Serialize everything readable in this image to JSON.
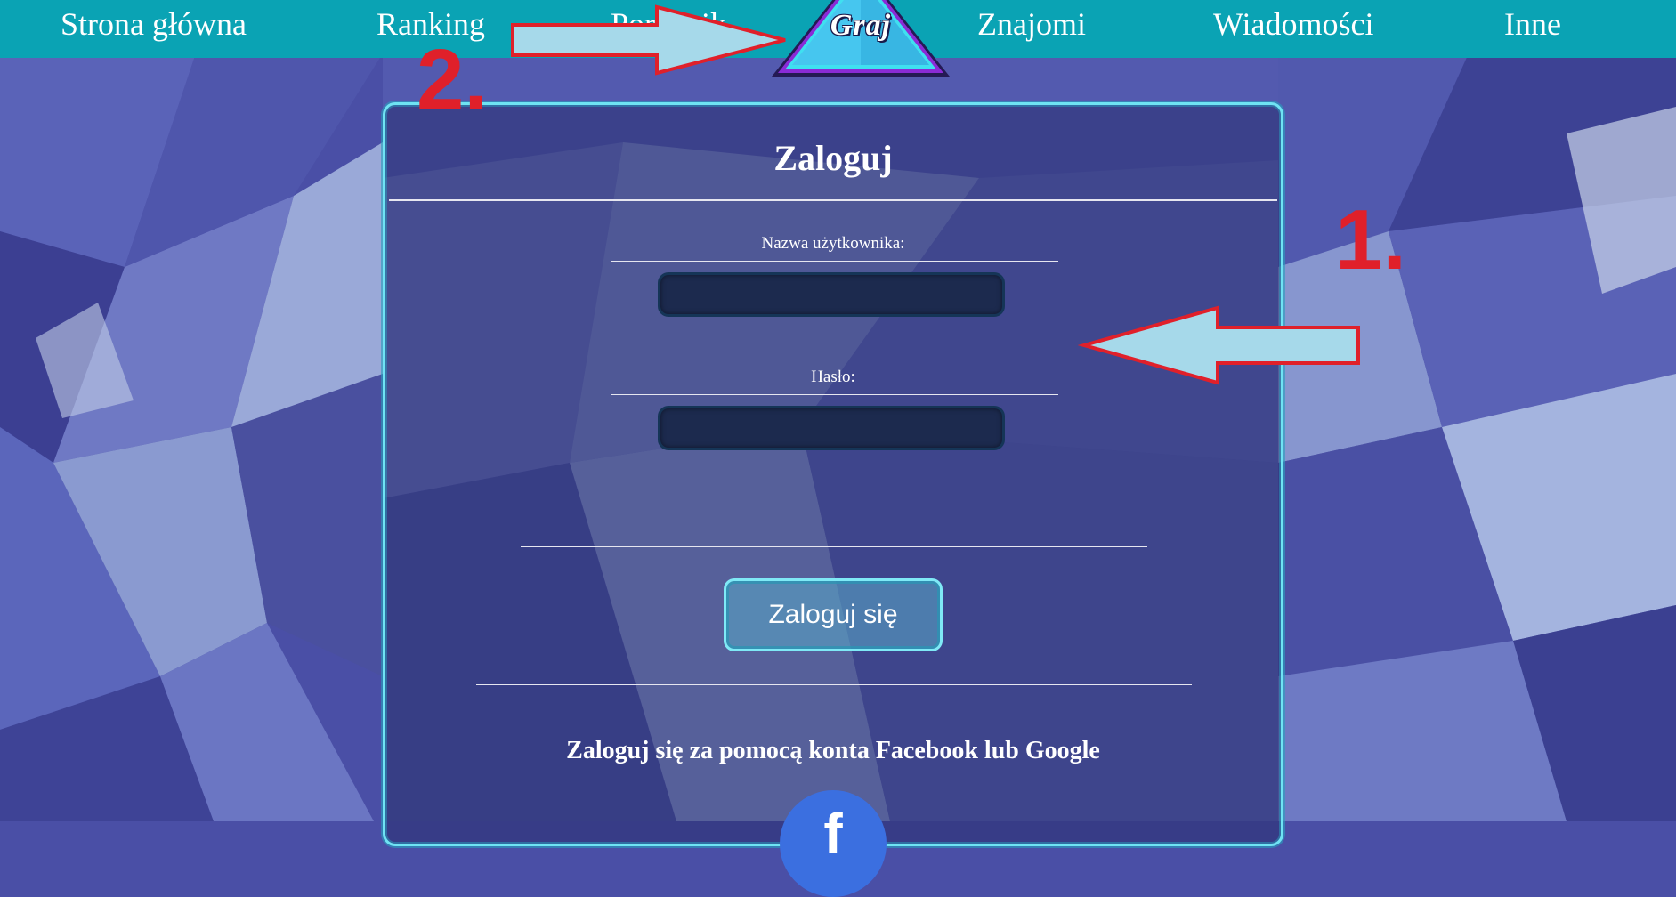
{
  "nav": {
    "items": [
      {
        "label": "Strona główna"
      },
      {
        "label": "Ranking"
      },
      {
        "label": "Poradnik"
      },
      {
        "label": "Znajomi"
      },
      {
        "label": "Wiadomości"
      },
      {
        "label": "Inne"
      }
    ],
    "play_logo_label": "Graj"
  },
  "login": {
    "title": "Zaloguj",
    "username_label": "Nazwa użytkownika:",
    "username_value": "",
    "password_label": "Hasło:",
    "password_value": "",
    "submit_label": "Zaloguj się",
    "social_text": "Zaloguj się za pomocą konta Facebook lub Google",
    "facebook_icon": "facebook-icon"
  },
  "annotations": {
    "marker_1": "1.",
    "marker_2": "2."
  },
  "colors": {
    "navbar": "#0aa3b4",
    "panel_border": "#6fe3f3",
    "annotation_red": "#e0202a",
    "arrow_fill": "#a6d9ea",
    "background": "#4a4fa6"
  }
}
